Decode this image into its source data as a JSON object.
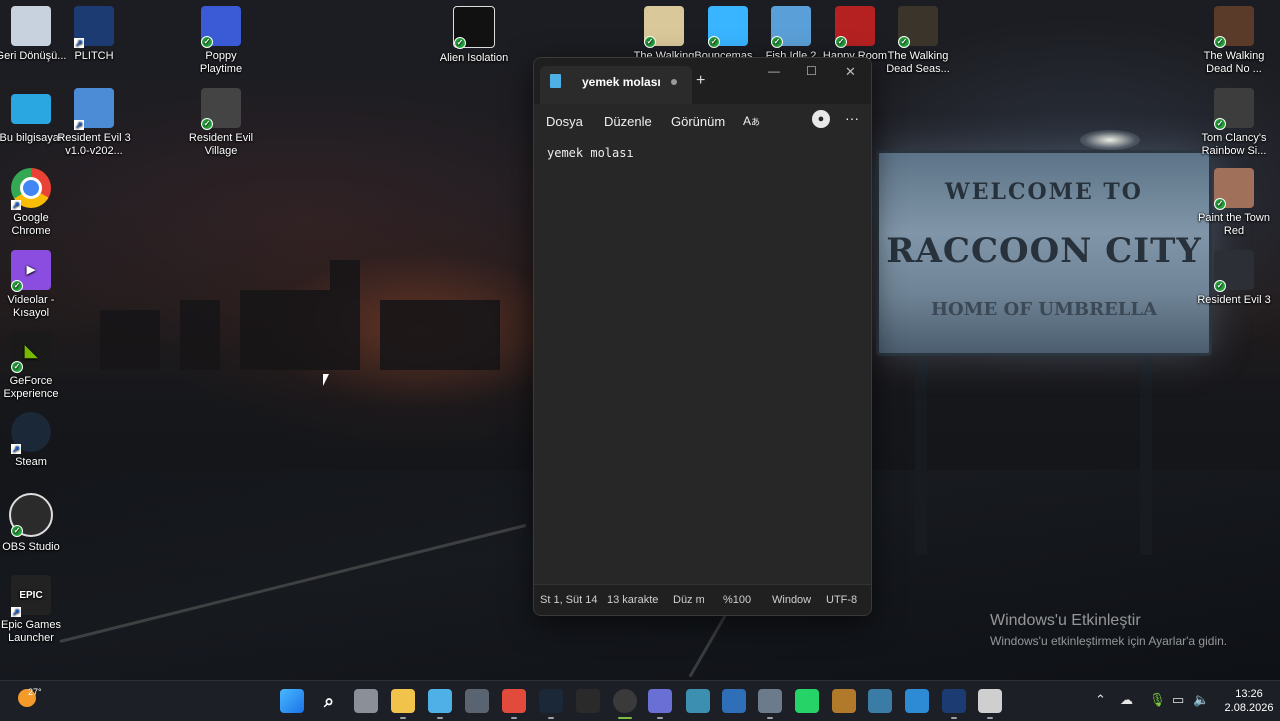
{
  "desktop_icons": [
    {
      "label": "Geri Dönüşü...",
      "icon": "recycle-bin-icon",
      "color": "#c7d2de"
    },
    {
      "label": "PLITCH",
      "icon": "plitch-icon",
      "color": "#1d3b73"
    },
    {
      "label": "Poppy Playtime",
      "icon": "poppy-playtime-icon",
      "color": "#3b5bd6"
    },
    {
      "label": "Alien Isolation",
      "icon": "alien-isolation-icon",
      "color": "#111111"
    },
    {
      "label": "The Walking",
      "icon": "walking-dead-icon",
      "color": "#d8c89a"
    },
    {
      "label": "Bouncemas...",
      "icon": "bouncemasters-icon",
      "color": "#39b4ff"
    },
    {
      "label": "Fish Idle 2",
      "icon": "fish-idle-icon",
      "color": "#5b9fd8"
    },
    {
      "label": "Happy Room",
      "icon": "happy-room-icon",
      "color": "#b52121"
    },
    {
      "label": "The Walking Dead Seas...",
      "icon": "walking-dead-season-icon",
      "color": "#3a342a"
    },
    {
      "label": "The Walking Dead No ...",
      "icon": "walking-dead-no-mans-land-icon",
      "color": "#5a3a28"
    },
    {
      "label": "Bu bilgisayar",
      "icon": "this-pc-icon",
      "color": "#2aa6e0"
    },
    {
      "label": "Resident Evil 3 v1.0-v202...",
      "icon": "resident-evil-3-trainer-icon",
      "color": "#4c8bd6"
    },
    {
      "label": "Resident Evil Village",
      "icon": "resident-evil-village-icon",
      "color": "#444444"
    },
    {
      "label": "Tom Clancy's Rainbow Si...",
      "icon": "rainbow-six-icon",
      "color": "#3d3d3d"
    },
    {
      "label": "Google Chrome",
      "icon": "chrome-icon",
      "color": "#ffffff"
    },
    {
      "label": "Paint the Town Red",
      "icon": "paint-the-town-red-icon",
      "color": "#a0705a"
    },
    {
      "label": "Videolar - Kısayol",
      "icon": "videos-folder-icon",
      "color": "#8a4de0"
    },
    {
      "label": "Resident Evil 3",
      "icon": "resident-evil-3-icon",
      "color": "#2c3036"
    },
    {
      "label": "GeForce Experience",
      "icon": "geforce-icon",
      "color": "#6bb52a"
    },
    {
      "label": "Steam",
      "icon": "steam-icon",
      "color": "#1b2838"
    },
    {
      "label": "OBS Studio",
      "icon": "obs-icon",
      "color": "#2b2b2b"
    },
    {
      "label": "Epic Games Launcher",
      "icon": "epic-games-icon",
      "color": "#222222"
    }
  ],
  "wallpaper": {
    "sign_line1": "WELCOME TO",
    "sign_line2": "RACCOON CITY",
    "sign_line3": "HOME OF UMBRELLA"
  },
  "activation": {
    "title": "Windows'u Etkinleştir",
    "subtitle": "Windows'u etkinleştirmek için Ayarlar'a gidin."
  },
  "notepad": {
    "tab_title": "yemek molası",
    "menu": [
      "Dosya",
      "Düzenle",
      "Görünüm"
    ],
    "content": "yemek molası",
    "status": {
      "position": "St 1, Süt 14",
      "chars": "13 karakter",
      "mode": "Düz metin",
      "zoom": "%100",
      "line_ending": "Windows (CRLF)",
      "encoding": "UTF-8"
    }
  },
  "taskbar": {
    "weather_temp": "27°",
    "time": "13:26",
    "date": "2.08.2026",
    "apps": [
      {
        "name": "start-icon",
        "color": "#3aa0ff"
      },
      {
        "name": "search-icon",
        "color": "#1c1f25"
      },
      {
        "name": "task-view-icon",
        "color": "#8a8f98"
      },
      {
        "name": "file-explorer-icon",
        "color": "#f2c34a"
      },
      {
        "name": "notepad-icon",
        "color": "#4fb0e8"
      },
      {
        "name": "calculator-icon",
        "color": "#5a6470"
      },
      {
        "name": "chrome-icon",
        "color": "#e24a3b"
      },
      {
        "name": "steam-icon",
        "color": "#1b2838"
      },
      {
        "name": "epic-games-icon",
        "color": "#2a2a2a"
      },
      {
        "name": "obs-icon",
        "color": "#3a3a3a"
      },
      {
        "name": "ubisoft-icon",
        "color": "#6a6fd6"
      },
      {
        "name": "keyboard-app-icon",
        "color": "#3c8fb0"
      },
      {
        "name": "solitaire-icon",
        "color": "#2f6fb7"
      },
      {
        "name": "settings-icon",
        "color": "#6b7b8c"
      },
      {
        "name": "whatsapp-icon",
        "color": "#25d366"
      },
      {
        "name": "game-icon",
        "color": "#b07a2a"
      },
      {
        "name": "vpn-icon",
        "color": "#3a7ca5"
      },
      {
        "name": "photos-icon",
        "color": "#2d8bd6"
      },
      {
        "name": "plitch-icon",
        "color": "#1d3b73"
      },
      {
        "name": "vr-icon",
        "color": "#cfcfcf"
      }
    ]
  }
}
